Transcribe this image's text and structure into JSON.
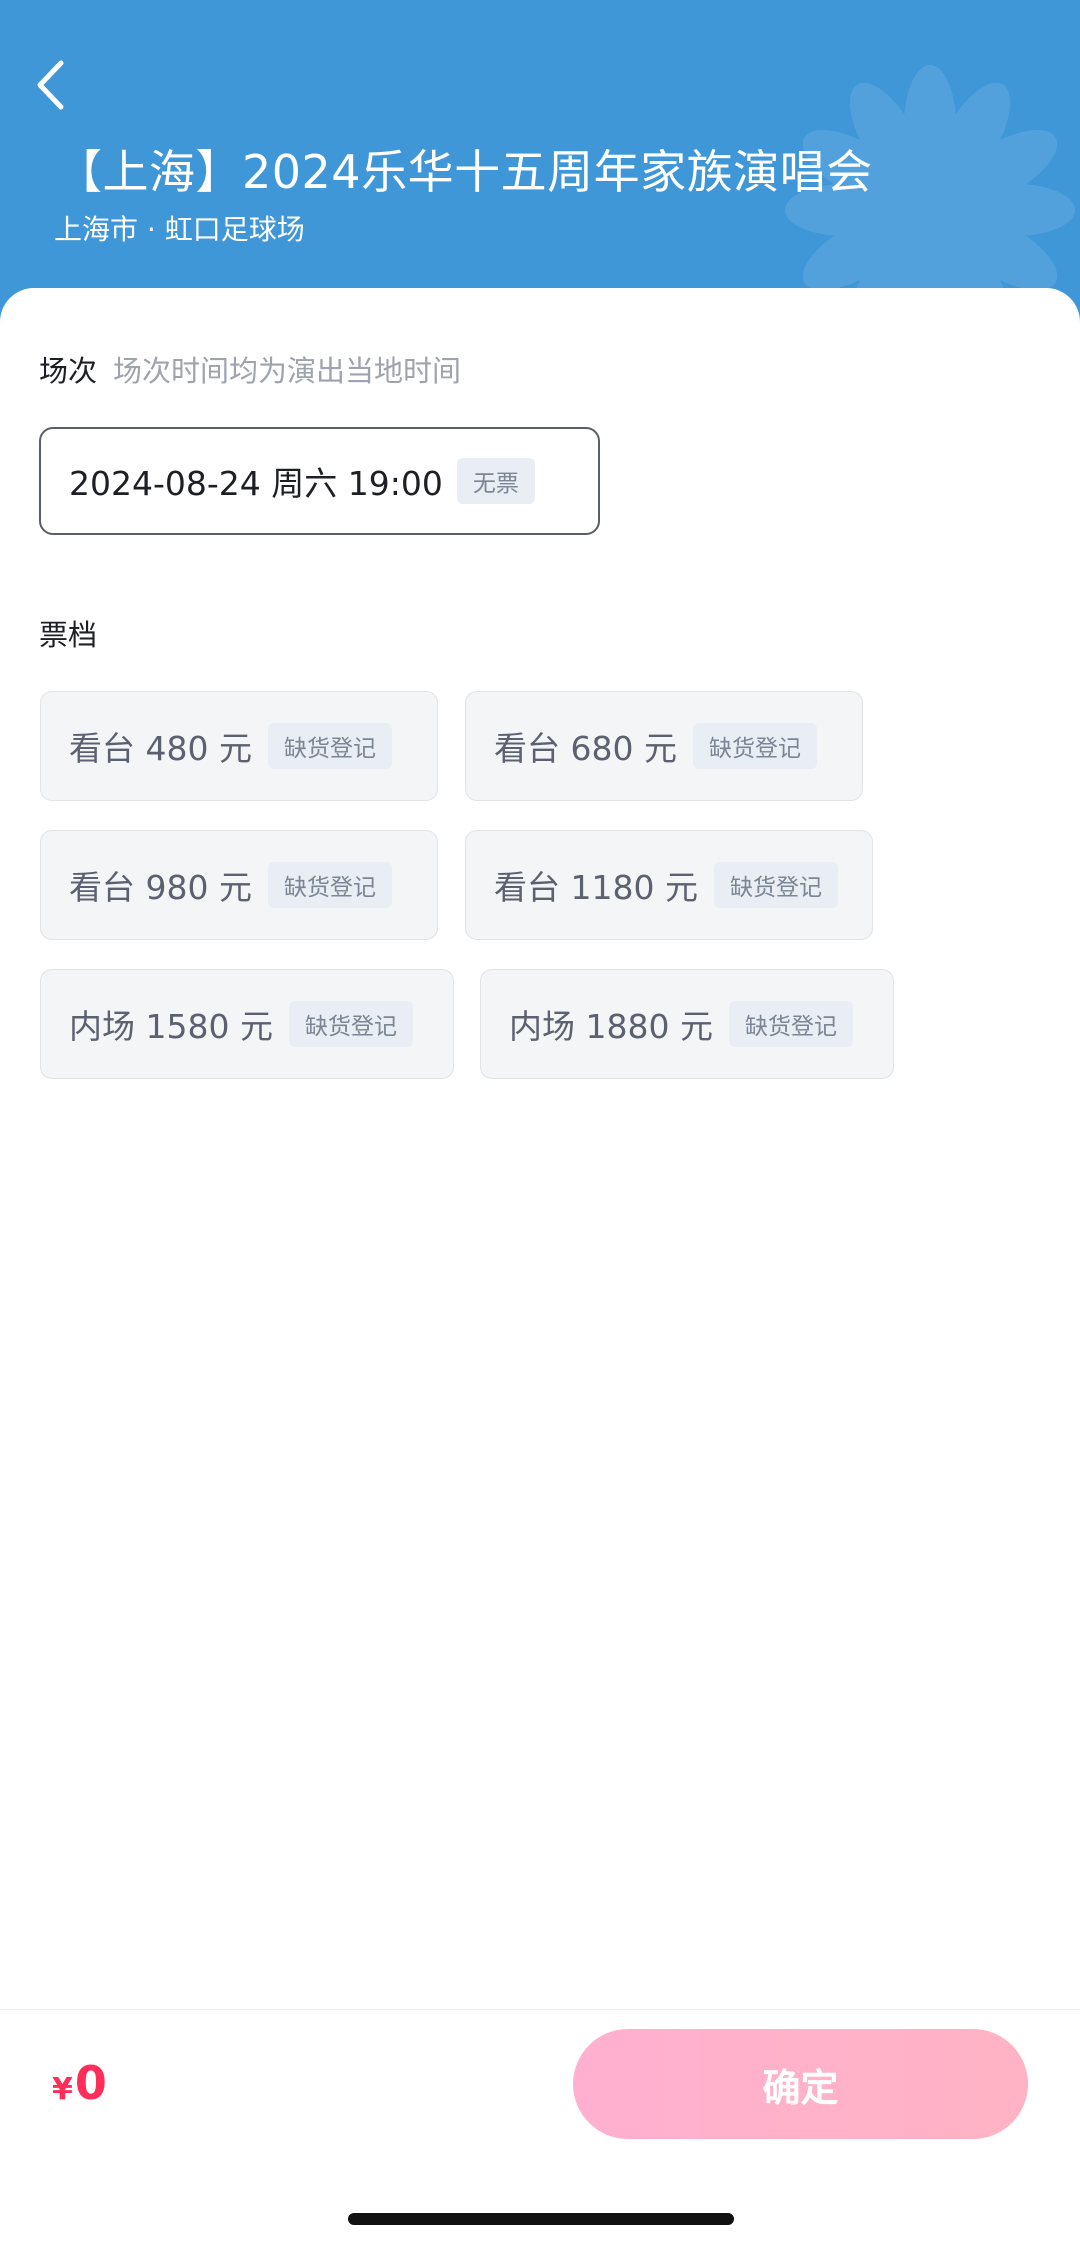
{
  "header": {
    "title": "【上海】2024乐华十五周年家族演唱会",
    "venue": "上海市 · 虹口足球场"
  },
  "session_section": {
    "title": "场次",
    "hint": "场次时间均为演出当地时间",
    "selected": {
      "datetime": "2024-08-24  周六 19:00",
      "badge": "无票"
    }
  },
  "tier_section": {
    "title": "票档",
    "tiers": [
      {
        "label": "看台 480 元",
        "badge": "缺货登记"
      },
      {
        "label": "看台 680 元",
        "badge": "缺货登记"
      },
      {
        "label": "看台 980 元",
        "badge": "缺货登记"
      },
      {
        "label": "看台 1180 元",
        "badge": "缺货登记"
      },
      {
        "label": "内场 1580 元",
        "badge": "缺货登记"
      },
      {
        "label": "内场 1880 元",
        "badge": "缺货登记"
      }
    ]
  },
  "footer": {
    "currency": "¥",
    "amount": "0",
    "confirm_label": "确定"
  },
  "colors": {
    "header_bg": "#3f97d8",
    "price_accent": "#ff2d5a",
    "confirm_gradient_start": "#ffb0d0",
    "confirm_gradient_end": "#ffb3c4"
  },
  "icons": {
    "back": "chevron-left-icon",
    "decoration": "flower-watermark-icon"
  }
}
